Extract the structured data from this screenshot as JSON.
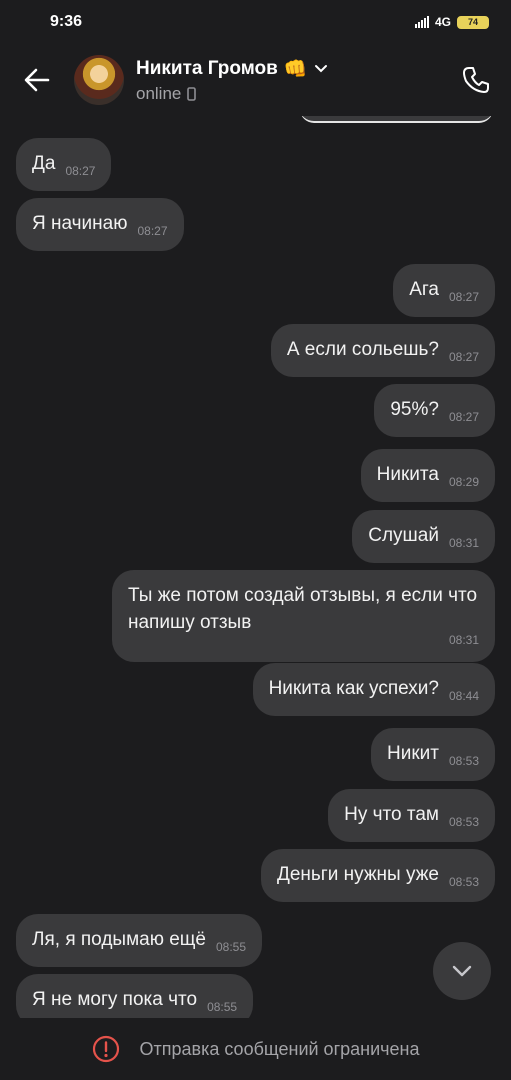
{
  "status_bar": {
    "time": "9:36",
    "network": "4G",
    "battery": "74"
  },
  "header": {
    "back_icon": "arrow-left-icon",
    "contact_name": "Никита Громов",
    "emoji": "👊",
    "presence": "online",
    "call_icon": "phone-icon"
  },
  "messages": [
    {
      "dir": "in",
      "text": "Да",
      "time": "08:27"
    },
    {
      "dir": "in",
      "text": "Я начинаю",
      "time": "08:27"
    },
    {
      "dir": "out",
      "text": "Ага",
      "time": "08:27"
    },
    {
      "dir": "out",
      "text": "А если сольешь?",
      "time": "08:27"
    },
    {
      "dir": "out",
      "text": "95%?",
      "time": "08:27"
    },
    {
      "dir": "out",
      "text": "Никита",
      "time": "08:29"
    },
    {
      "dir": "out",
      "text": "Слушай",
      "time": "08:31"
    },
    {
      "dir": "out",
      "text": "Ты же потом создай отзывы, я если что напишу отзыв",
      "time": "08:31"
    },
    {
      "dir": "out",
      "text": "Никита как успехи?",
      "time": "08:44"
    },
    {
      "dir": "out",
      "text": "Никит",
      "time": "08:53"
    },
    {
      "dir": "out",
      "text": "Ну что там",
      "time": "08:53"
    },
    {
      "dir": "out",
      "text": "Деньги нужны уже",
      "time": "08:53"
    },
    {
      "dir": "in",
      "text": "Ля, я подымаю ещё",
      "time": "08:55"
    },
    {
      "dir": "in",
      "text": "Я не могу пока что",
      "time": "08:55"
    }
  ],
  "restriction": {
    "icon": "alert-circle-icon",
    "text": "Отправка сообщений ограничена",
    "color": "#e5534b"
  }
}
